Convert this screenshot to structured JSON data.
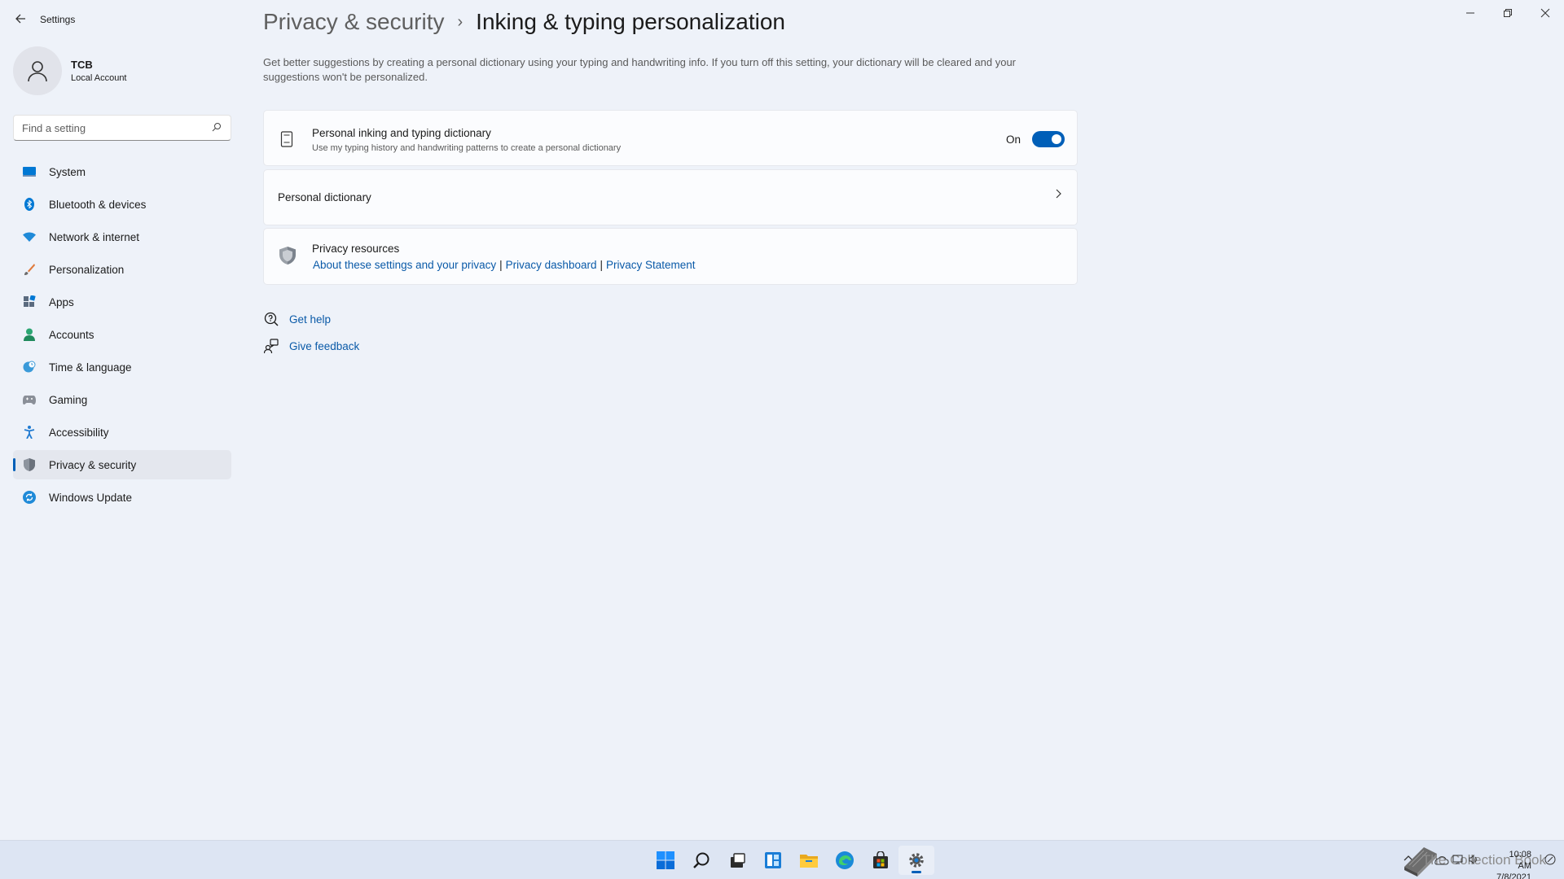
{
  "app": {
    "title": "Settings",
    "controls": {
      "minimize": "–",
      "restore": "❐",
      "close": "✕"
    }
  },
  "user": {
    "name": "TCB",
    "account_type": "Local Account"
  },
  "search": {
    "placeholder": "Find a setting"
  },
  "sidebar": {
    "items": [
      {
        "label": "System",
        "icon": "system-icon"
      },
      {
        "label": "Bluetooth & devices",
        "icon": "bluetooth-icon"
      },
      {
        "label": "Network & internet",
        "icon": "wifi-icon"
      },
      {
        "label": "Personalization",
        "icon": "brush-icon"
      },
      {
        "label": "Apps",
        "icon": "apps-icon"
      },
      {
        "label": "Accounts",
        "icon": "person-icon"
      },
      {
        "label": "Time & language",
        "icon": "globe-clock-icon"
      },
      {
        "label": "Gaming",
        "icon": "gamepad-icon"
      },
      {
        "label": "Accessibility",
        "icon": "accessibility-icon"
      },
      {
        "label": "Privacy & security",
        "icon": "shield-icon",
        "active": true
      },
      {
        "label": "Windows Update",
        "icon": "update-icon"
      }
    ]
  },
  "breadcrumb": {
    "parent": "Privacy & security",
    "separator": "›",
    "current": "Inking & typing personalization"
  },
  "main": {
    "description": "Get better suggestions by creating a personal dictionary using your typing and handwriting info. If you turn off this setting, your dictionary will be cleared and your suggestions won't be personalized.",
    "dictionary_setting": {
      "title": "Personal inking and typing dictionary",
      "subtitle": "Use my typing history and handwriting patterns to create a personal dictionary",
      "state_label": "On",
      "enabled": true
    },
    "personal_dictionary": {
      "title": "Personal dictionary"
    },
    "privacy_resources": {
      "title": "Privacy resources",
      "links": [
        "About these settings and your privacy",
        "Privacy dashboard",
        "Privacy Statement"
      ],
      "separator": "|"
    },
    "get_help": "Get help",
    "give_feedback": "Give feedback"
  },
  "taskbar": {
    "apps": [
      "start-icon",
      "search-icon",
      "task-view-icon",
      "widgets-icon",
      "file-explorer-icon",
      "edge-icon",
      "store-icon",
      "settings-icon"
    ],
    "active_app": "settings-icon",
    "watermark": "The Collection Book",
    "time": "10:08 AM",
    "date": "7/8/2021"
  },
  "colors": {
    "accent": "#005fb8",
    "link": "#0a5aa8",
    "background": "#eef2f9"
  }
}
